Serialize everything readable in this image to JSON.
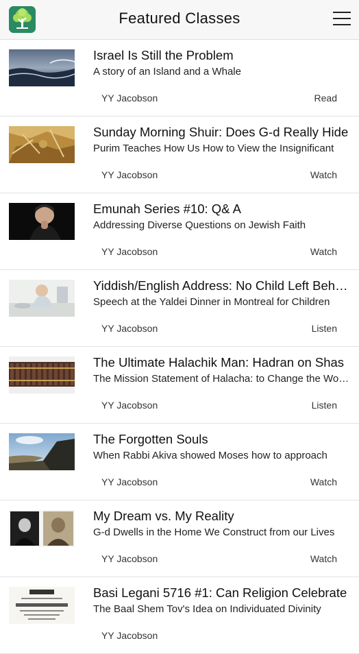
{
  "header": {
    "title": "Featured Classes",
    "logo_icon": "tree-icon",
    "menu_icon": "hamburger-menu-icon"
  },
  "classes": [
    {
      "title": "Israel Is Still the Problem",
      "subtitle": "A story of an Island and a Whale",
      "author": "YY Jacobson",
      "action": "Read",
      "thumb": "stormy-sea"
    },
    {
      "title": "Sunday Morning Shuir: Does G-d Really Hide",
      "subtitle": "Purim Teaches How Us How to View the Insignificant",
      "author": "YY Jacobson",
      "action": "Watch",
      "thumb": "golden-parchment"
    },
    {
      "title": "Emunah Series #10: Q& A",
      "subtitle": "Addressing Diverse Questions on Jewish Faith",
      "author": "YY Jacobson",
      "action": "Watch",
      "thumb": "man-in-thought"
    },
    {
      "title": "Yiddish/English Address: No Child Left Behind",
      "subtitle": "Speech at the Yaldei Dinner in Montreal for Children",
      "author": "YY Jacobson",
      "action": "Listen",
      "thumb": "child-at-table"
    },
    {
      "title": "The Ultimate Halachik Man: Hadran on Shas",
      "subtitle": "The Mission Statement of Halacha: to Change the World",
      "author": "YY Jacobson",
      "action": "Listen",
      "thumb": "book-shelf"
    },
    {
      "title": "The Forgotten Souls",
      "subtitle": "When Rabbi Akiva showed Moses how to approach",
      "author": "YY Jacobson",
      "action": "Watch",
      "thumb": "mountain-sky"
    },
    {
      "title": "My Dream vs. My Reality",
      "subtitle": "G-d Dwells in the Home We Construct from our Lives",
      "author": "YY Jacobson",
      "action": "Watch",
      "thumb": "two-portraits"
    },
    {
      "title": "Basi Legani 5716 #1: Can Religion Celebrate",
      "subtitle": "The Baal Shem Tov's Idea on Individuated Divinity",
      "author": "YY Jacobson",
      "action": "",
      "thumb": "hebrew-title-page"
    }
  ]
}
